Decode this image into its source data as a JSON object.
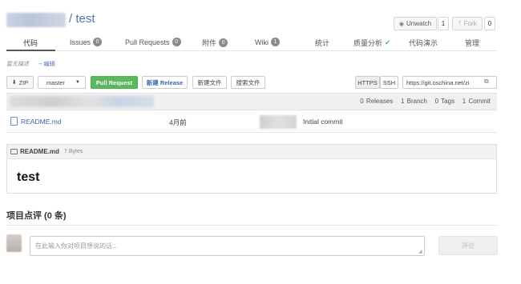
{
  "repo": {
    "name": "/ test"
  },
  "header": {
    "watch_label": "Unwatch",
    "watch_count": "1",
    "fork_label": "Fork",
    "fork_count": "0"
  },
  "tabs": [
    {
      "label": "代码",
      "badge": null,
      "icon": null
    },
    {
      "label": "Issues",
      "badge": "0",
      "icon": null
    },
    {
      "label": "Pull Requests",
      "badge": "0",
      "icon": null
    },
    {
      "label": "附件",
      "badge": "0",
      "icon": null
    },
    {
      "label": "Wiki",
      "badge": "1",
      "icon": null
    },
    {
      "label": "统计",
      "badge": null,
      "icon": null
    },
    {
      "label": "质量分析",
      "badge": null,
      "icon": "check-icon"
    },
    {
      "label": "代码演示",
      "badge": null,
      "icon": null
    },
    {
      "label": "管理",
      "badge": null,
      "icon": null
    }
  ],
  "description": {
    "text": "暂无描述",
    "edit_label": "-- 编辑"
  },
  "toolbar": {
    "zip_label": "ZIP",
    "branch": "master",
    "pull_request_label": "Pull Request",
    "new_release_label": "新建 Release",
    "new_file_label": "新建文件",
    "search_file_label": "搜索文件",
    "https_label": "HTTPS",
    "ssh_label": "SSH",
    "clone_url": "https://git.oschina.net/zi"
  },
  "stats": {
    "releases": "0 Releases",
    "branches": "1 Branch",
    "tags": "0 Tags",
    "commits": "1 Commit"
  },
  "files": [
    {
      "name": "README.md",
      "time": "4月前",
      "message": "Initial commit"
    }
  ],
  "readme": {
    "filename": "README.md",
    "size": "7 Bytes",
    "heading": "test"
  },
  "comments": {
    "title": "项目点评 (0 条)",
    "placeholder": "在此输入你对项目想说的话...",
    "submit_label": "评论"
  },
  "colors": {
    "accent": "#4a74b8",
    "pr_button": "#5cb85c",
    "check": "#5cb85c"
  }
}
